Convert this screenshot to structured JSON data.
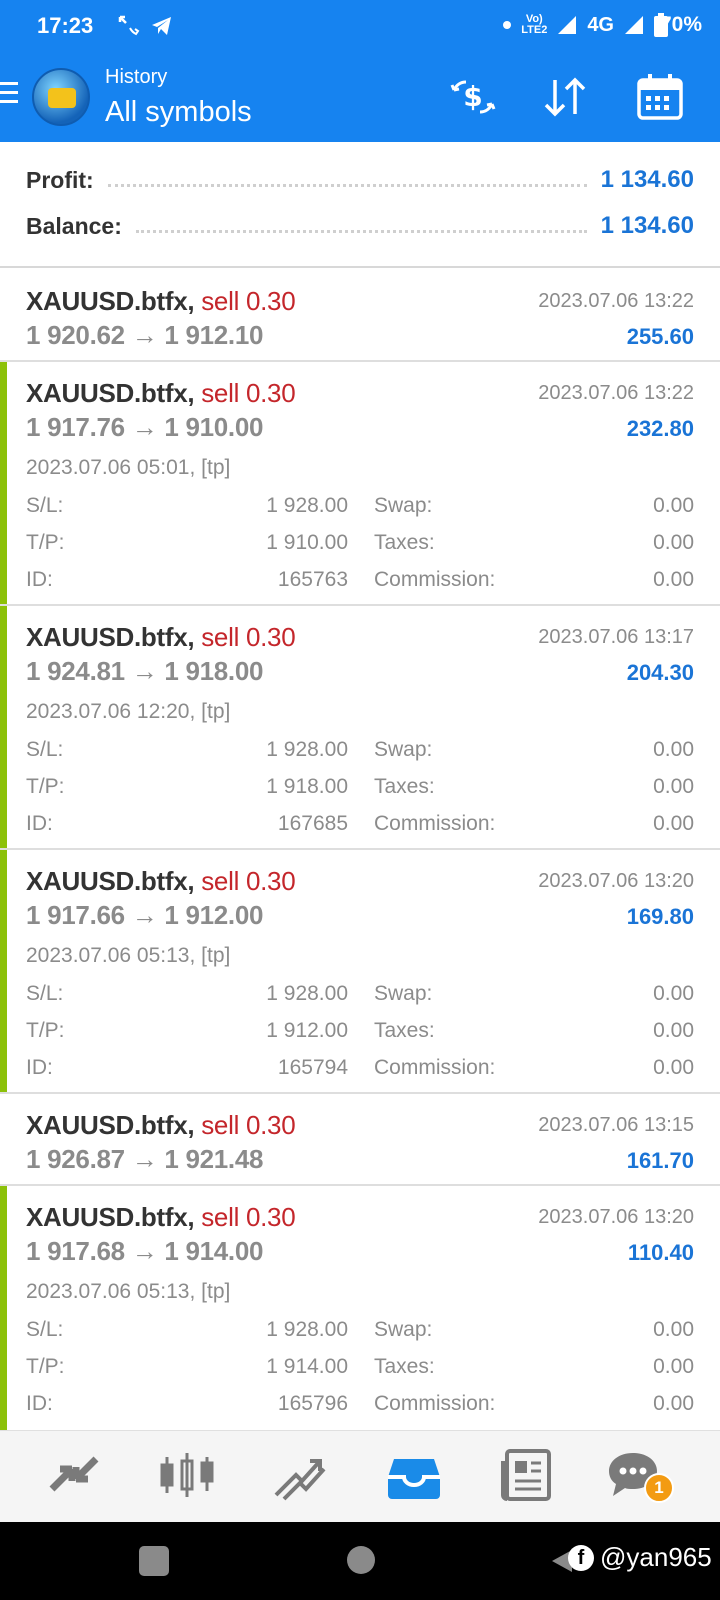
{
  "status_bar": {
    "time": "17:23",
    "network_label": "4G",
    "battery": "70%",
    "icons": [
      "missed-call-icon",
      "telegram-icon",
      "dot-icon",
      "volte-icon",
      "signal-icon",
      "wifi-signal-icon",
      "battery-icon"
    ]
  },
  "app_bar": {
    "subtitle": "History",
    "title": "All symbols",
    "actions": [
      "currency-exchange-icon",
      "sort-icon",
      "calendar-icon"
    ]
  },
  "summary": {
    "profit_label": "Profit:",
    "profit_value": "1 134.60",
    "balance_label": "Balance:",
    "balance_value": "1 134.60"
  },
  "deals": [
    {
      "symbol": "XAUUSD.btfx,",
      "side": "sell 0.30",
      "prices": "1 920.62 → 1 912.10",
      "datetime": "2023.07.06 13:22",
      "profit": "255.60",
      "expanded": false
    },
    {
      "symbol": "XAUUSD.btfx,",
      "side": "sell 0.30",
      "prices": "1 917.76 → 1 910.00",
      "datetime": "2023.07.06 13:22",
      "profit": "232.80",
      "expanded": true,
      "opened": "2023.07.06 05:01, [tp]",
      "sl_label": "S/L:",
      "sl": "1 928.00",
      "tp_label": "T/P:",
      "tp": "1 910.00",
      "id_label": "ID:",
      "id": "165763",
      "swap_label": "Swap:",
      "swap": "0.00",
      "taxes_label": "Taxes:",
      "taxes": "0.00",
      "commission_label": "Commission:",
      "commission": "0.00"
    },
    {
      "symbol": "XAUUSD.btfx,",
      "side": "sell 0.30",
      "prices": "1 924.81 → 1 918.00",
      "datetime": "2023.07.06 13:17",
      "profit": "204.30",
      "expanded": true,
      "opened": "2023.07.06 12:20, [tp]",
      "sl_label": "S/L:",
      "sl": "1 928.00",
      "tp_label": "T/P:",
      "tp": "1 918.00",
      "id_label": "ID:",
      "id": "167685",
      "swap_label": "Swap:",
      "swap": "0.00",
      "taxes_label": "Taxes:",
      "taxes": "0.00",
      "commission_label": "Commission:",
      "commission": "0.00"
    },
    {
      "symbol": "XAUUSD.btfx,",
      "side": "sell 0.30",
      "prices": "1 917.66 → 1 912.00",
      "datetime": "2023.07.06 13:20",
      "profit": "169.80",
      "expanded": true,
      "opened": "2023.07.06 05:13, [tp]",
      "sl_label": "S/L:",
      "sl": "1 928.00",
      "tp_label": "T/P:",
      "tp": "1 912.00",
      "id_label": "ID:",
      "id": "165794",
      "swap_label": "Swap:",
      "swap": "0.00",
      "taxes_label": "Taxes:",
      "taxes": "0.00",
      "commission_label": "Commission:",
      "commission": "0.00"
    },
    {
      "symbol": "XAUUSD.btfx,",
      "side": "sell 0.30",
      "prices": "1 926.87 → 1 921.48",
      "datetime": "2023.07.06 13:15",
      "profit": "161.70",
      "expanded": false
    },
    {
      "symbol": "XAUUSD.btfx,",
      "side": "sell 0.30",
      "prices": "1 917.68 → 1 914.00",
      "datetime": "2023.07.06 13:20",
      "profit": "110.40",
      "expanded": true,
      "opened": "2023.07.06 05:13, [tp]",
      "sl_label": "S/L:",
      "sl": "1 928.00",
      "tp_label": "T/P:",
      "tp": "1 914.00",
      "id_label": "ID:",
      "id": "165796",
      "swap_label": "Swap:",
      "swap": "0.00",
      "taxes_label": "Taxes:",
      "taxes": "0.00",
      "commission_label": "Commission:",
      "commission": "0.00"
    }
  ],
  "bottom_nav": {
    "items": [
      "quotes-icon",
      "chart-icon",
      "trade-icon",
      "history-icon",
      "news-icon",
      "chat-icon"
    ],
    "active": "history-icon",
    "chat_badge": "1"
  },
  "watermark": {
    "text": "@yan965",
    "icon": "facebook-icon"
  },
  "colors": {
    "primary": "#1683f0",
    "sell": "#c4262b",
    "profit": "#1a74d6",
    "accent_bar": "#8cc10a",
    "badge": "#f39b12"
  }
}
